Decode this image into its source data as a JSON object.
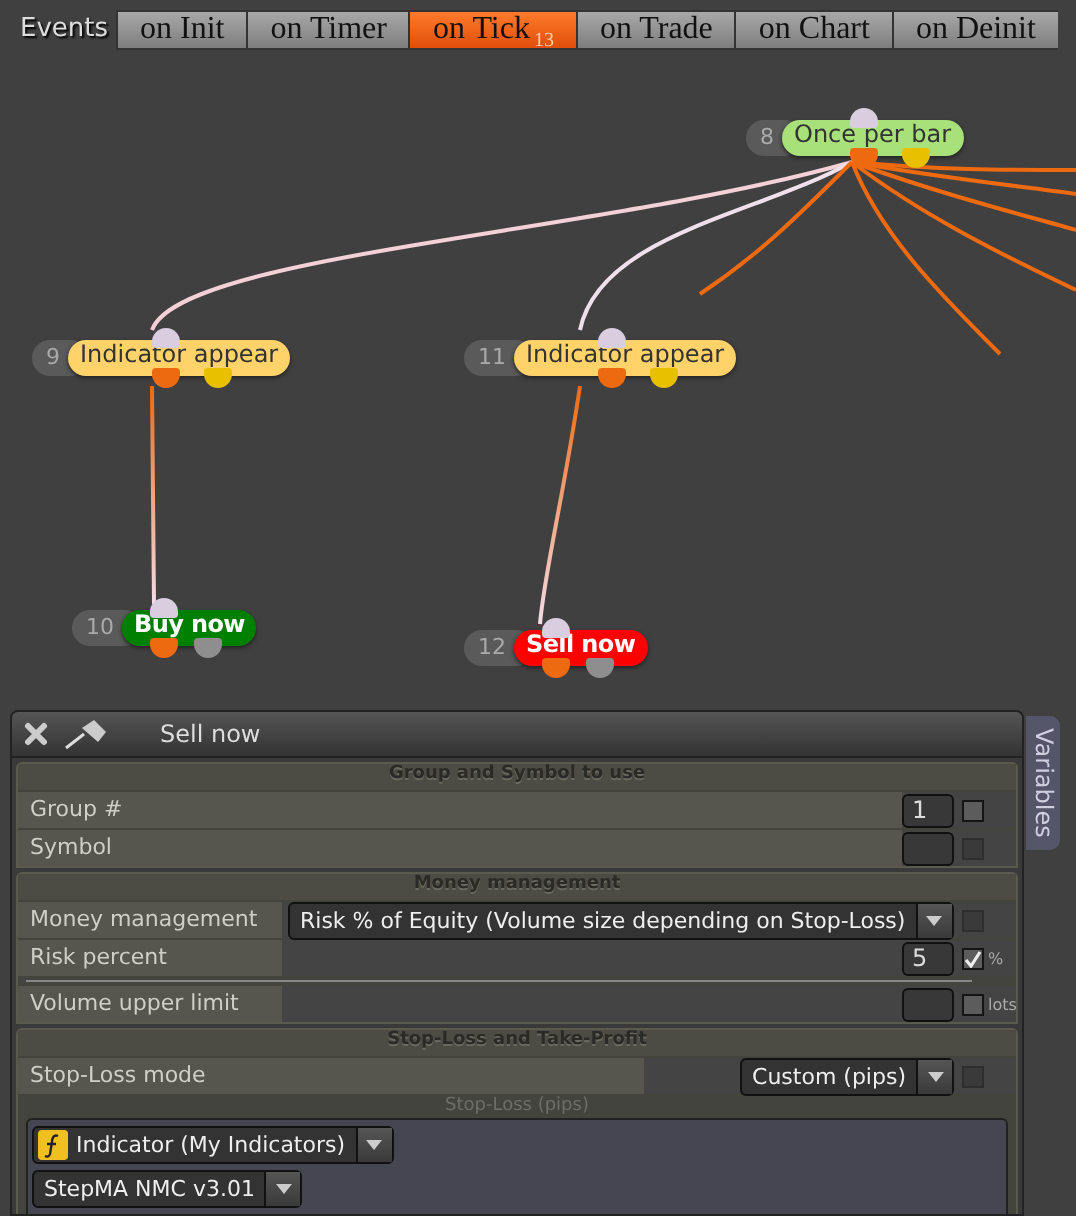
{
  "events_label": "Events",
  "tabs": [
    {
      "label": "on Init",
      "selected": false
    },
    {
      "label": "on Timer",
      "selected": false
    },
    {
      "label": "on Tick",
      "selected": true,
      "badge": "13"
    },
    {
      "label": "on Trade",
      "selected": false
    },
    {
      "label": "on Chart",
      "selected": false
    },
    {
      "label": "on Deinit",
      "selected": false
    }
  ],
  "nodes": [
    {
      "number": "8",
      "label": "Once per bar",
      "kind": "condition",
      "color": "#a8e07a"
    },
    {
      "number": "9",
      "label": "Indicator appear",
      "kind": "condition",
      "color": "#ffd36a"
    },
    {
      "number": "11",
      "label": "Indicator appear",
      "kind": "condition",
      "color": "#ffd36a"
    },
    {
      "number": "10",
      "label": "Buy now",
      "kind": "action",
      "color": "#008000"
    },
    {
      "number": "12",
      "label": "Sell now",
      "kind": "action",
      "color": "#ff0000"
    }
  ],
  "panel": {
    "title": "Sell now",
    "side_tab": "Variables",
    "sections": [
      {
        "title": "Group and Symbol to use",
        "rows": [
          {
            "kind": "field",
            "label": "Group #",
            "value": "1",
            "checkbox": {
              "checked": false,
              "disabled": false
            }
          },
          {
            "kind": "field",
            "label": "Symbol",
            "checkbox": {
              "checked": false,
              "disabled": true
            }
          }
        ]
      },
      {
        "title": "Money management",
        "rows": [
          {
            "kind": "dropdown",
            "label": "Money management",
            "value": "Risk % of Equity (Volume size depending on Stop-Loss)",
            "checkbox": {
              "checked": false,
              "disabled": true
            }
          },
          {
            "kind": "field",
            "label": "Risk percent",
            "value": "5",
            "checkbox": {
              "checked": true,
              "disabled": false
            },
            "unit": "%"
          },
          {
            "kind": "divider"
          },
          {
            "kind": "field",
            "label": "Volume upper limit",
            "checkbox": {
              "checked": false,
              "disabled": false
            },
            "unit": "lots"
          }
        ]
      },
      {
        "title": "Stop-Loss and Take-Profit",
        "rows": [
          {
            "kind": "dropdown",
            "label": "Stop-Loss mode",
            "value": "Custom (pips)",
            "checkbox": {
              "checked": false,
              "disabled": true
            }
          },
          {
            "kind": "group",
            "title": "Stop-Loss (pips)",
            "items": [
              {
                "kind": "indicator",
                "value": "Indicator (My Indicators)"
              },
              {
                "kind": "plain",
                "value": "StepMA NMC v3.01"
              }
            ]
          }
        ]
      }
    ]
  }
}
